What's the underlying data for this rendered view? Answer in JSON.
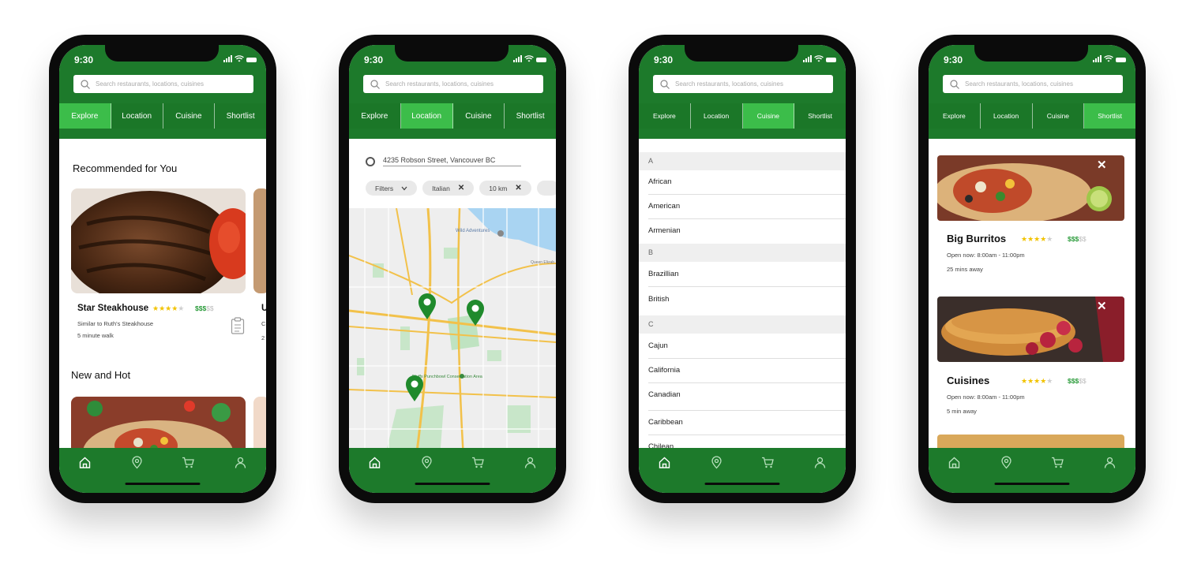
{
  "status": {
    "time": "9:30"
  },
  "search": {
    "placeholder": "Search restaurants, locations, cuisines"
  },
  "tabs": [
    "Explore",
    "Location",
    "Cuisine",
    "Shortlist"
  ],
  "colors": {
    "header": "#1d7a2b",
    "active_tab": "#3cbd4a",
    "star": "#f2c300",
    "price": "#2a9b3a"
  },
  "nav": [
    "home-icon",
    "location-pin-icon",
    "cart-icon",
    "user-icon"
  ],
  "explore": {
    "recommended_title": "Recommended for You",
    "card": {
      "name": "Star Steakhouse",
      "stars": "★★★★",
      "stars_off": "★",
      "price": "$$$",
      "price_off": "$$",
      "similar": "Similar to Ruth's Steakhouse",
      "distance": "5 minute walk"
    },
    "peek_name": "U",
    "peek_meta1": "C",
    "peek_meta2": "2",
    "new_title": "New and Hot"
  },
  "location": {
    "address": "4235 Robson Street, Vancouver BC",
    "filters_label": "Filters",
    "chips": [
      "Italian",
      "10 km"
    ],
    "map_labels": {
      "poi": "Wild Adventures",
      "park": "Bluffs Punchbowl Conservation Area",
      "road": "Queen Elizab"
    }
  },
  "cuisine": {
    "groups": [
      {
        "letter": "A",
        "items": [
          "African",
          "American",
          "Armenian"
        ]
      },
      {
        "letter": "B",
        "items": [
          "Brazillian",
          "British"
        ]
      },
      {
        "letter": "C",
        "items": [
          "Cajun",
          "California",
          "Canadian",
          "Caribbean",
          "Chilean"
        ]
      }
    ]
  },
  "shortlist": {
    "close": "✕",
    "items": [
      {
        "name": "Big Burritos",
        "stars": "★★★★",
        "stars_off": "★",
        "price": "$$$",
        "price_off": "$$",
        "hours": "Open now: 8:00am - 11:00pm",
        "away": "25 mins away"
      },
      {
        "name": "Cuisines",
        "stars": "★★★★",
        "stars_off": "★",
        "price": "$$$",
        "price_off": "$$",
        "hours": "Open now: 8:00am - 11:00pm",
        "away": "5 min away"
      }
    ]
  }
}
